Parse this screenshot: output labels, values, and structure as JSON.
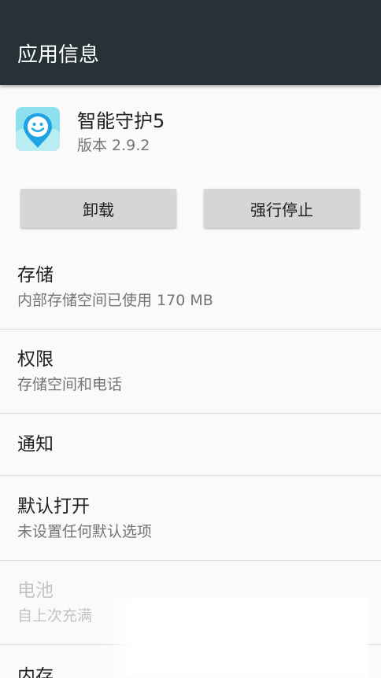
{
  "toolbar": {
    "title": "应用信息"
  },
  "app": {
    "name": "智能守护5",
    "version": "版本 2.9.2"
  },
  "buttons": {
    "uninstall": "卸载",
    "force_stop": "强行停止"
  },
  "rows": {
    "storage": {
      "title": "存储",
      "subtitle": "内部存储空间已使用 170 MB"
    },
    "permissions": {
      "title": "权限",
      "subtitle": "存储空间和电话"
    },
    "notifications": {
      "title": "通知"
    },
    "open_default": {
      "title": "默认打开",
      "subtitle": "未设置任何默认选项"
    },
    "battery": {
      "title": "电池",
      "subtitle": "自上次充满"
    },
    "memory": {
      "title": "内存"
    }
  },
  "colors": {
    "toolbar": "#263238",
    "background": "#fafafa",
    "button": "#d6d6d6",
    "icon_bg": "#7fd8e8",
    "icon_pin": "#1fa3e6"
  }
}
